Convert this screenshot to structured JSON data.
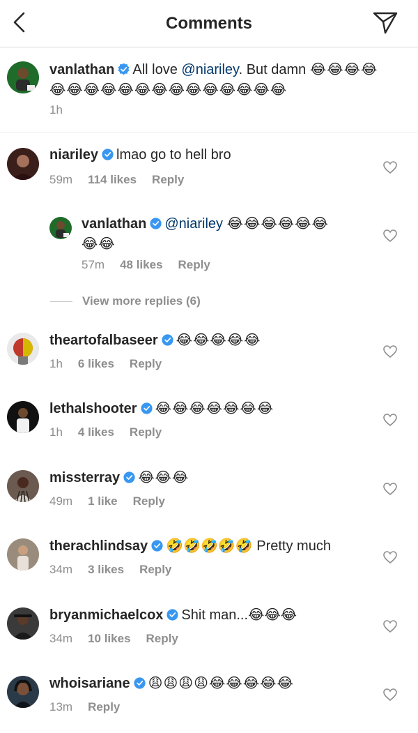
{
  "header": {
    "title": "Comments"
  },
  "caption": {
    "username": "vanlathan",
    "text_before": "All love ",
    "mention": "@niariley",
    "text_after": ". But damn ",
    "emoji_line1": "😂😂😂😂",
    "emoji_line2": "😂😂😂😂😂😂😂😂😂😂😂😂😂😂",
    "time": "1h"
  },
  "comments": [
    {
      "username": "niariley",
      "text": "lmao go to hell bro",
      "time": "59m",
      "likes": "114 likes",
      "reply": "Reply"
    },
    {
      "username": "vanlathan",
      "mention": "@niariley",
      "emoji_line1": "😂😂😂😂😂😂",
      "emoji_line2": "😂😂",
      "time": "57m",
      "likes": "48 likes",
      "reply": "Reply"
    },
    {
      "username": "theartofalbaseer",
      "text": "😂😂😂😂😂",
      "time": "1h",
      "likes": "6 likes",
      "reply": "Reply"
    },
    {
      "username": "lethalshooter",
      "text": "😂😂😂😂😂😂😂",
      "time": "1h",
      "likes": "4 likes",
      "reply": "Reply"
    },
    {
      "username": "missterray",
      "text": "😂😂😂",
      "time": "49m",
      "likes": "1 like",
      "reply": "Reply"
    },
    {
      "username": "therachlindsay",
      "text": "🤣🤣🤣🤣🤣 Pretty much",
      "time": "34m",
      "likes": "3 likes",
      "reply": "Reply"
    },
    {
      "username": "bryanmichaelcox",
      "text": "Shit man...😂😂😂",
      "time": "34m",
      "likes": "10 likes",
      "reply": "Reply"
    },
    {
      "username": "whoisariane",
      "text": "😩😩😩😩😂😂😂😂😂",
      "time": "13m",
      "reply": "Reply"
    }
  ],
  "view_more": "View more replies (6)",
  "colors": {
    "verified": "#3897f0",
    "mention": "#00376b",
    "meta": "#8e8e8e"
  },
  "icons": {
    "back": "chevron-left-icon",
    "send": "paper-plane-icon",
    "like": "heart-outline-icon",
    "verified": "verified-badge-icon"
  }
}
